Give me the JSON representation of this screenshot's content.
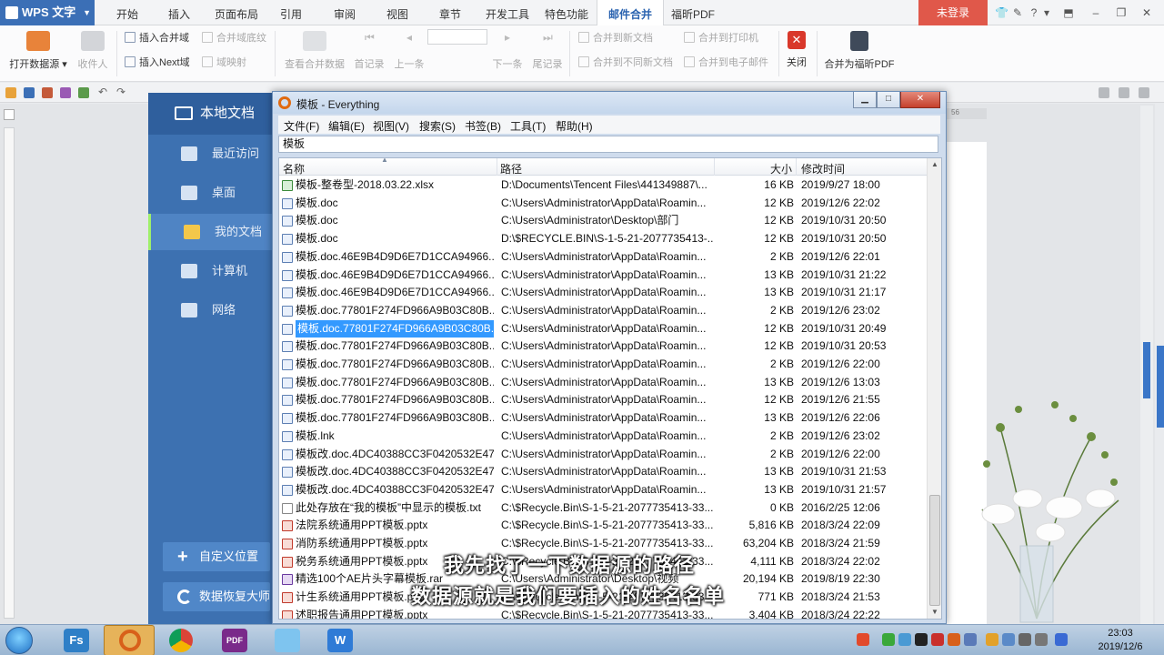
{
  "wps": {
    "app_name": "WPS 文字",
    "tabs": [
      "开始",
      "插入",
      "页面布局",
      "引用",
      "审阅",
      "视图",
      "章节",
      "开发工具",
      "特色功能",
      "邮件合并",
      "福昕PDF"
    ],
    "active_tab": "邮件合并",
    "login_label": "未登录",
    "ribbon": {
      "open_source": "打开数据源",
      "recipients": "收件人",
      "insert_merge_field": "插入合并域",
      "merge_field_shading": "合并域底纹",
      "insert_next_field": "插入Next域",
      "field_mapping": "域映射",
      "view_merged": "查看合并数据",
      "first_record": "首记录",
      "prev_record": "上一条",
      "next_record": "下一条",
      "last_record": "尾记录",
      "merge_new_doc": "合并到新文档",
      "merge_printer": "合并到打印机",
      "merge_diff_docs": "合并到不同新文档",
      "merge_email": "合并到电子邮件",
      "close": "关闭",
      "merge_foxit": "合并为福昕PDF"
    },
    "page_marker": "56"
  },
  "sidebar": {
    "title": "本地文档",
    "items": [
      "最近访问",
      "桌面",
      "我的文档",
      "计算机",
      "网络"
    ],
    "active": "我的文档",
    "custom_location": "自定义位置",
    "data_recovery": "数据恢复大师"
  },
  "everything": {
    "title": "模板 - Everything",
    "menu": [
      "文件(F)",
      "编辑(E)",
      "视图(V)",
      "搜索(S)",
      "书签(B)",
      "工具(T)",
      "帮助(H)"
    ],
    "search_value": "模板",
    "columns": {
      "name": "名称",
      "path": "路径",
      "size": "大小",
      "modified": "修改时间"
    },
    "rows": [
      {
        "icon": "xl",
        "name": "模板-整卷型-2018.03.22.xlsx",
        "path": "D:\\Documents\\Tencent Files\\441349887\\...",
        "size": "16 KB",
        "date": "2019/9/27 18:00"
      },
      {
        "icon": "doc",
        "name": "模板.doc",
        "path": "C:\\Users\\Administrator\\AppData\\Roamin...",
        "size": "12 KB",
        "date": "2019/12/6 22:02"
      },
      {
        "icon": "doc",
        "name": "模板.doc",
        "path": "C:\\Users\\Administrator\\Desktop\\部门",
        "size": "12 KB",
        "date": "2019/10/31 20:50"
      },
      {
        "icon": "doc",
        "name": "模板.doc",
        "path": "D:\\$RECYCLE.BIN\\S-1-5-21-2077735413-...",
        "size": "12 KB",
        "date": "2019/10/31 20:50"
      },
      {
        "icon": "doc",
        "name": "模板.doc.46E9B4D9D6E7D1CCA94966...",
        "path": "C:\\Users\\Administrator\\AppData\\Roamin...",
        "size": "2 KB",
        "date": "2019/12/6 22:01"
      },
      {
        "icon": "doc",
        "name": "模板.doc.46E9B4D9D6E7D1CCA94966...",
        "path": "C:\\Users\\Administrator\\AppData\\Roamin...",
        "size": "13 KB",
        "date": "2019/10/31 21:22"
      },
      {
        "icon": "doc",
        "name": "模板.doc.46E9B4D9D6E7D1CCA94966...",
        "path": "C:\\Users\\Administrator\\AppData\\Roamin...",
        "size": "13 KB",
        "date": "2019/10/31 21:17"
      },
      {
        "icon": "doc",
        "name": "模板.doc.77801F274FD966A9B03C80B...",
        "path": "C:\\Users\\Administrator\\AppData\\Roamin...",
        "size": "2 KB",
        "date": "2019/12/6 23:02"
      },
      {
        "icon": "doc",
        "name": "模板.doc.77801F274FD966A9B03C80B...",
        "path": "C:\\Users\\Administrator\\AppData\\Roamin...",
        "size": "12 KB",
        "date": "2019/10/31 20:49",
        "selected": true
      },
      {
        "icon": "doc",
        "name": "模板.doc.77801F274FD966A9B03C80B...",
        "path": "C:\\Users\\Administrator\\AppData\\Roamin...",
        "size": "12 KB",
        "date": "2019/10/31 20:53"
      },
      {
        "icon": "doc",
        "name": "模板.doc.77801F274FD966A9B03C80B...",
        "path": "C:\\Users\\Administrator\\AppData\\Roamin...",
        "size": "2 KB",
        "date": "2019/12/6 22:00"
      },
      {
        "icon": "doc",
        "name": "模板.doc.77801F274FD966A9B03C80B...",
        "path": "C:\\Users\\Administrator\\AppData\\Roamin...",
        "size": "13 KB",
        "date": "2019/12/6 13:03"
      },
      {
        "icon": "doc",
        "name": "模板.doc.77801F274FD966A9B03C80B...",
        "path": "C:\\Users\\Administrator\\AppData\\Roamin...",
        "size": "12 KB",
        "date": "2019/12/6 21:55"
      },
      {
        "icon": "doc",
        "name": "模板.doc.77801F274FD966A9B03C80B...",
        "path": "C:\\Users\\Administrator\\AppData\\Roamin...",
        "size": "13 KB",
        "date": "2019/12/6 22:06"
      },
      {
        "icon": "doc",
        "name": "模板.lnk",
        "path": "C:\\Users\\Administrator\\AppData\\Roamin...",
        "size": "2 KB",
        "date": "2019/12/6 23:02"
      },
      {
        "icon": "doc",
        "name": "模板改.doc.4DC40388CC3F0420532E47...",
        "path": "C:\\Users\\Administrator\\AppData\\Roamin...",
        "size": "2 KB",
        "date": "2019/12/6 22:00"
      },
      {
        "icon": "doc",
        "name": "模板改.doc.4DC40388CC3F0420532E47...",
        "path": "C:\\Users\\Administrator\\AppData\\Roamin...",
        "size": "13 KB",
        "date": "2019/10/31 21:53"
      },
      {
        "icon": "doc",
        "name": "模板改.doc.4DC40388CC3F0420532E47...",
        "path": "C:\\Users\\Administrator\\AppData\\Roamin...",
        "size": "13 KB",
        "date": "2019/10/31 21:57"
      },
      {
        "icon": "txt",
        "name": "此处存放在“我的模板”中显示的模板.txt",
        "path": "C:\\$Recycle.Bin\\S-1-5-21-2077735413-33...",
        "size": "0 KB",
        "date": "2016/2/25 12:06"
      },
      {
        "icon": "ppt",
        "name": "法院系统通用PPT模板.pptx",
        "path": "C:\\$Recycle.Bin\\S-1-5-21-2077735413-33...",
        "size": "5,816 KB",
        "date": "2018/3/24 22:09"
      },
      {
        "icon": "ppt",
        "name": "消防系统通用PPT模板.pptx",
        "path": "C:\\$Recycle.Bin\\S-1-5-21-2077735413-33...",
        "size": "63,204 KB",
        "date": "2018/3/24 21:59"
      },
      {
        "icon": "ppt",
        "name": "税务系统通用PPT模板.pptx",
        "path": "C:\\$Recycle.Bin\\S-1-5-21-2077735413-33...",
        "size": "4,111 KB",
        "date": "2018/3/24 22:02"
      },
      {
        "icon": "rar",
        "name": "精选100个AE片头字幕模板.rar",
        "path": "C:\\Users\\Administrator\\Desktop\\视频",
        "size": "20,194 KB",
        "date": "2019/8/19 22:30"
      },
      {
        "icon": "ppt",
        "name": "计生系统通用PPT模板.pptx",
        "path": "C:\\$Recycle.Bin\\S-1-5-21-2077735413-33...",
        "size": "771 KB",
        "date": "2018/3/24 21:53"
      },
      {
        "icon": "ppt",
        "name": "述职报告通用PPT模板.pptx",
        "path": "C:\\$Recycle.Bin\\S-1-5-21-2077735413-33...",
        "size": "3,404 KB",
        "date": "2018/3/24 22:22"
      }
    ]
  },
  "subtitles": {
    "line1": "我先找了一下数据源的路径",
    "line2": "数据源就是我们要插入的姓名名单"
  },
  "taskbar": {
    "apps": [
      "Fs",
      "Everything",
      "Chrome",
      "PDF",
      "QQ",
      "WPS"
    ],
    "time": "23:03",
    "date": "2019/12/6"
  },
  "colors": {
    "wps_blue": "#3b6fb6",
    "sidebar_blue": "#3d71b1",
    "selection": "#3399ff",
    "login_red": "#e0584a"
  }
}
